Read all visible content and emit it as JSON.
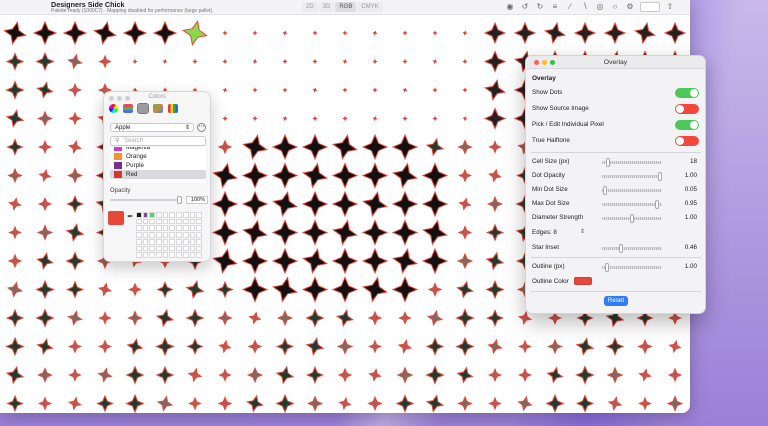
{
  "app": {
    "title": "Designers Side Chick",
    "status": "Palette ready (1000C7) · Mapping disabled for performance (large pallet)."
  },
  "toolbar": {
    "modes": [
      {
        "label": "2D",
        "active": false
      },
      {
        "label": "3D",
        "active": false
      },
      {
        "label": "RGB",
        "active": true
      },
      {
        "label": "CMYK",
        "active": false
      }
    ],
    "icons": [
      "palette-icon",
      "undo-icon",
      "redo-icon",
      "list-icon",
      "brush-icon",
      "eyedropper-icon",
      "globe-icon",
      "shape-icon",
      "settings-icon",
      "field-icon",
      "share-icon"
    ]
  },
  "colors": {
    "title": "Colors",
    "palette": "Apple",
    "search_placeholder": "Search",
    "items": [
      {
        "name": "Magenta",
        "color": "#c43bd6",
        "selected": false
      },
      {
        "name": "Orange",
        "color": "#f4922b",
        "selected": false
      },
      {
        "name": "Purple",
        "color": "#7b2d9c",
        "selected": false
      },
      {
        "name": "Red",
        "color": "#d8372d",
        "selected": true
      }
    ],
    "opacity_label": "Opacity",
    "opacity_value": "100%",
    "opacity": 1.0,
    "current_color": "#e8473c",
    "recent_swatches": [
      "#1a1a1a",
      "#7b4aa0",
      "#4fd94c"
    ]
  },
  "overlay": {
    "title": "Overlay",
    "section": "Overlay",
    "toggles": [
      {
        "label": "Show Dots",
        "on": true
      },
      {
        "label": "Show Source Image",
        "on": false
      },
      {
        "label": "Pick / Edit Individual Pixel",
        "on": true
      },
      {
        "label": "True Halftone",
        "on": false
      }
    ],
    "sliders": [
      {
        "label": "Cell Size (px)",
        "value": "18",
        "level": 0.08
      },
      {
        "label": "Dot Opacity",
        "value": "1.00",
        "level": 1.0
      },
      {
        "label": "Min Dot Size",
        "value": "0.05",
        "level": 0.02
      },
      {
        "label": "Max Dot Size",
        "value": "0.95",
        "level": 0.95
      },
      {
        "label": "Diameter Strength",
        "value": "1.00",
        "level": 0.5
      }
    ],
    "edges_label": "Edges: 8",
    "star_inset": {
      "label": "Star Inset",
      "value": "0.46",
      "level": 0.3
    },
    "outline_px": {
      "label": "Outline (px)",
      "value": "1.00",
      "level": 0.05
    },
    "outline_color_label": "Outline Color",
    "outline_color": "#e8473c",
    "reset_label": "Reset"
  },
  "canvas": {
    "outline_color": "#e8473c",
    "selected_fill": "#8ad84c"
  }
}
